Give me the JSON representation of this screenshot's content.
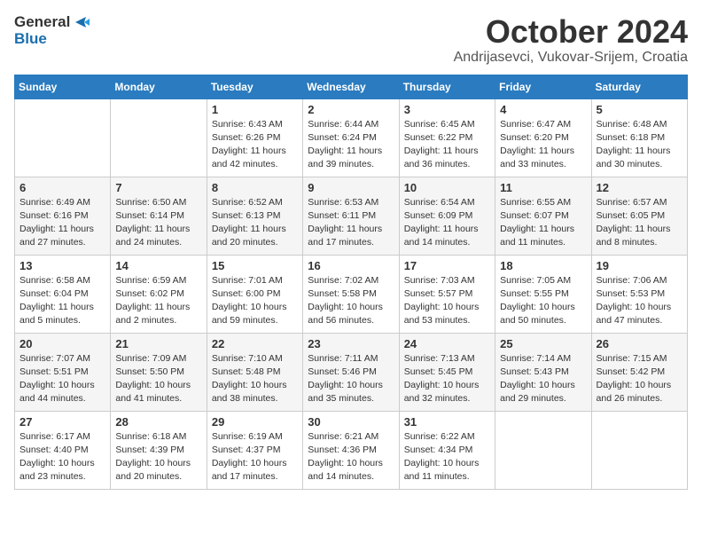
{
  "logo": {
    "general": "General",
    "blue": "Blue"
  },
  "header": {
    "month": "October 2024",
    "location": "Andrijasevci, Vukovar-Srijem, Croatia"
  },
  "days_of_week": [
    "Sunday",
    "Monday",
    "Tuesday",
    "Wednesday",
    "Thursday",
    "Friday",
    "Saturday"
  ],
  "weeks": [
    [
      {
        "day": "",
        "sunrise": "",
        "sunset": "",
        "daylight": ""
      },
      {
        "day": "",
        "sunrise": "",
        "sunset": "",
        "daylight": ""
      },
      {
        "day": "1",
        "sunrise": "Sunrise: 6:43 AM",
        "sunset": "Sunset: 6:26 PM",
        "daylight": "Daylight: 11 hours and 42 minutes."
      },
      {
        "day": "2",
        "sunrise": "Sunrise: 6:44 AM",
        "sunset": "Sunset: 6:24 PM",
        "daylight": "Daylight: 11 hours and 39 minutes."
      },
      {
        "day": "3",
        "sunrise": "Sunrise: 6:45 AM",
        "sunset": "Sunset: 6:22 PM",
        "daylight": "Daylight: 11 hours and 36 minutes."
      },
      {
        "day": "4",
        "sunrise": "Sunrise: 6:47 AM",
        "sunset": "Sunset: 6:20 PM",
        "daylight": "Daylight: 11 hours and 33 minutes."
      },
      {
        "day": "5",
        "sunrise": "Sunrise: 6:48 AM",
        "sunset": "Sunset: 6:18 PM",
        "daylight": "Daylight: 11 hours and 30 minutes."
      }
    ],
    [
      {
        "day": "6",
        "sunrise": "Sunrise: 6:49 AM",
        "sunset": "Sunset: 6:16 PM",
        "daylight": "Daylight: 11 hours and 27 minutes."
      },
      {
        "day": "7",
        "sunrise": "Sunrise: 6:50 AM",
        "sunset": "Sunset: 6:14 PM",
        "daylight": "Daylight: 11 hours and 24 minutes."
      },
      {
        "day": "8",
        "sunrise": "Sunrise: 6:52 AM",
        "sunset": "Sunset: 6:13 PM",
        "daylight": "Daylight: 11 hours and 20 minutes."
      },
      {
        "day": "9",
        "sunrise": "Sunrise: 6:53 AM",
        "sunset": "Sunset: 6:11 PM",
        "daylight": "Daylight: 11 hours and 17 minutes."
      },
      {
        "day": "10",
        "sunrise": "Sunrise: 6:54 AM",
        "sunset": "Sunset: 6:09 PM",
        "daylight": "Daylight: 11 hours and 14 minutes."
      },
      {
        "day": "11",
        "sunrise": "Sunrise: 6:55 AM",
        "sunset": "Sunset: 6:07 PM",
        "daylight": "Daylight: 11 hours and 11 minutes."
      },
      {
        "day": "12",
        "sunrise": "Sunrise: 6:57 AM",
        "sunset": "Sunset: 6:05 PM",
        "daylight": "Daylight: 11 hours and 8 minutes."
      }
    ],
    [
      {
        "day": "13",
        "sunrise": "Sunrise: 6:58 AM",
        "sunset": "Sunset: 6:04 PM",
        "daylight": "Daylight: 11 hours and 5 minutes."
      },
      {
        "day": "14",
        "sunrise": "Sunrise: 6:59 AM",
        "sunset": "Sunset: 6:02 PM",
        "daylight": "Daylight: 11 hours and 2 minutes."
      },
      {
        "day": "15",
        "sunrise": "Sunrise: 7:01 AM",
        "sunset": "Sunset: 6:00 PM",
        "daylight": "Daylight: 10 hours and 59 minutes."
      },
      {
        "day": "16",
        "sunrise": "Sunrise: 7:02 AM",
        "sunset": "Sunset: 5:58 PM",
        "daylight": "Daylight: 10 hours and 56 minutes."
      },
      {
        "day": "17",
        "sunrise": "Sunrise: 7:03 AM",
        "sunset": "Sunset: 5:57 PM",
        "daylight": "Daylight: 10 hours and 53 minutes."
      },
      {
        "day": "18",
        "sunrise": "Sunrise: 7:05 AM",
        "sunset": "Sunset: 5:55 PM",
        "daylight": "Daylight: 10 hours and 50 minutes."
      },
      {
        "day": "19",
        "sunrise": "Sunrise: 7:06 AM",
        "sunset": "Sunset: 5:53 PM",
        "daylight": "Daylight: 10 hours and 47 minutes."
      }
    ],
    [
      {
        "day": "20",
        "sunrise": "Sunrise: 7:07 AM",
        "sunset": "Sunset: 5:51 PM",
        "daylight": "Daylight: 10 hours and 44 minutes."
      },
      {
        "day": "21",
        "sunrise": "Sunrise: 7:09 AM",
        "sunset": "Sunset: 5:50 PM",
        "daylight": "Daylight: 10 hours and 41 minutes."
      },
      {
        "day": "22",
        "sunrise": "Sunrise: 7:10 AM",
        "sunset": "Sunset: 5:48 PM",
        "daylight": "Daylight: 10 hours and 38 minutes."
      },
      {
        "day": "23",
        "sunrise": "Sunrise: 7:11 AM",
        "sunset": "Sunset: 5:46 PM",
        "daylight": "Daylight: 10 hours and 35 minutes."
      },
      {
        "day": "24",
        "sunrise": "Sunrise: 7:13 AM",
        "sunset": "Sunset: 5:45 PM",
        "daylight": "Daylight: 10 hours and 32 minutes."
      },
      {
        "day": "25",
        "sunrise": "Sunrise: 7:14 AM",
        "sunset": "Sunset: 5:43 PM",
        "daylight": "Daylight: 10 hours and 29 minutes."
      },
      {
        "day": "26",
        "sunrise": "Sunrise: 7:15 AM",
        "sunset": "Sunset: 5:42 PM",
        "daylight": "Daylight: 10 hours and 26 minutes."
      }
    ],
    [
      {
        "day": "27",
        "sunrise": "Sunrise: 6:17 AM",
        "sunset": "Sunset: 4:40 PM",
        "daylight": "Daylight: 10 hours and 23 minutes."
      },
      {
        "day": "28",
        "sunrise": "Sunrise: 6:18 AM",
        "sunset": "Sunset: 4:39 PM",
        "daylight": "Daylight: 10 hours and 20 minutes."
      },
      {
        "day": "29",
        "sunrise": "Sunrise: 6:19 AM",
        "sunset": "Sunset: 4:37 PM",
        "daylight": "Daylight: 10 hours and 17 minutes."
      },
      {
        "day": "30",
        "sunrise": "Sunrise: 6:21 AM",
        "sunset": "Sunset: 4:36 PM",
        "daylight": "Daylight: 10 hours and 14 minutes."
      },
      {
        "day": "31",
        "sunrise": "Sunrise: 6:22 AM",
        "sunset": "Sunset: 4:34 PM",
        "daylight": "Daylight: 10 hours and 11 minutes."
      },
      {
        "day": "",
        "sunrise": "",
        "sunset": "",
        "daylight": ""
      },
      {
        "day": "",
        "sunrise": "",
        "sunset": "",
        "daylight": ""
      }
    ]
  ]
}
